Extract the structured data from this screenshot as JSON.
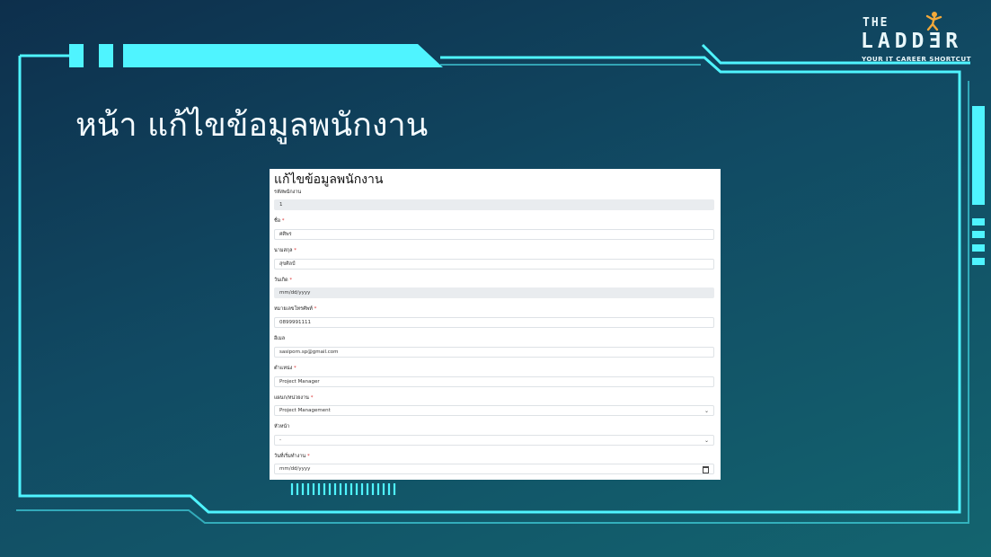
{
  "slide": {
    "title": "หน้า แก้ไขข้อมูลพนักงาน"
  },
  "logo": {
    "the": "THE",
    "ladder": "LADDƎR",
    "tagline": "YOUR IT CAREER SHORTCUT"
  },
  "form": {
    "title": "แก้ไขข้อมูลพนักงาน",
    "fields": [
      {
        "label": "รหัสพนักงาน",
        "required": "",
        "value": "1"
      },
      {
        "label": "ชื่อ",
        "required": "*",
        "value": "ศศิพร"
      },
      {
        "label": "นามสกุล",
        "required": "*",
        "value": "สุขศิลป์"
      },
      {
        "label": "วันเกิด",
        "required": "*",
        "value": "mm/dd/yyyy"
      },
      {
        "label": "หมายเลขโทรศัพท์",
        "required": "*",
        "value": "0899991111"
      },
      {
        "label": "อีเมล",
        "required": "",
        "value": "sasiporn.sp@gmail.com"
      },
      {
        "label": "ตำแหน่ง",
        "required": "*",
        "value": "Project Manager"
      },
      {
        "label": "แผนก/หน่วยงาน",
        "required": "*",
        "value": "Project Management"
      },
      {
        "label": "หัวหน้า",
        "required": "",
        "value": "-"
      },
      {
        "label": "วันที่เริ่มทำงาน",
        "required": "*",
        "value": "mm/dd/yyyy"
      }
    ]
  },
  "colors": {
    "accent": "#4ff4ff",
    "background_top": "#0d2f4c",
    "background_bottom": "#13646f"
  }
}
